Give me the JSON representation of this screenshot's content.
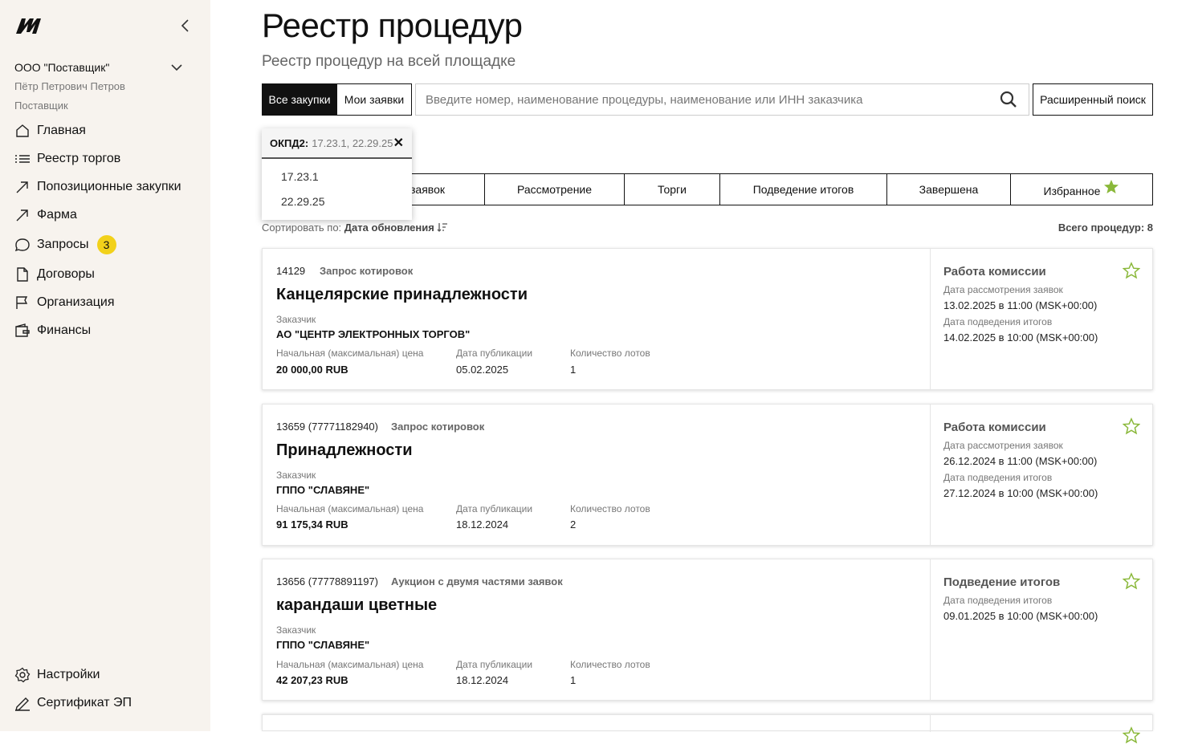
{
  "sidebar": {
    "org": "ООО \"Поставщик\"",
    "user_name": "Пётр Петрович Петров",
    "user_role": "Поставщик",
    "nav": [
      {
        "label": "Главная",
        "icon": "home-icon"
      },
      {
        "label": "Реестр торгов",
        "icon": "list-icon"
      },
      {
        "label": "Попозиционные закупки",
        "icon": "arrow-up-right-icon"
      },
      {
        "label": "Фарма",
        "icon": "arrow-up-right-icon"
      },
      {
        "label": "Запросы",
        "icon": "chat-icon",
        "badge": "3"
      },
      {
        "label": "Договоры",
        "icon": "document-icon"
      },
      {
        "label": "Организация",
        "icon": "flag-icon"
      },
      {
        "label": "Финансы",
        "icon": "wallet-icon"
      }
    ],
    "bottom": [
      {
        "label": "Настройки",
        "icon": "gear-icon"
      },
      {
        "label": "Сертификат ЭП",
        "icon": "signature-icon"
      }
    ]
  },
  "header": {
    "title": "Реестр процедур",
    "subtitle": "Реестр процедур на всей площадке"
  },
  "toolbar": {
    "all_label": "Все закупки",
    "mine_label": "Мои заявки",
    "search_placeholder": "Введите номер, наименование процедуры, наименование или ИНН заказчика",
    "advanced_label": "Расширенный поиск"
  },
  "filter": {
    "name": "ОКПД2:",
    "values": "17.23.1, 22.29.25",
    "options": [
      "17.23.1",
      "22.29.25"
    ]
  },
  "tabs": [
    "Подача заявок",
    "Рассмотрение",
    "Торги",
    "Подведение итогов",
    "Завершена",
    "Избранное"
  ],
  "tab_visible_first": "заявок",
  "sort": {
    "label": "Сортировать по:",
    "value": "Дата обновления"
  },
  "total": "Всего процедур: 8",
  "labels": {
    "customer": "Заказчик",
    "price": "Начальная (максимальная) цена",
    "pub_date": "Дата публикации",
    "lots": "Количество лотов"
  },
  "cards": [
    {
      "number": "14129",
      "type": "Запрос котировок",
      "name": "Канцелярские принадлежности",
      "customer": "АО \"ЦЕНТР ЭЛЕКТРОННЫХ ТОРГОВ\"",
      "price": "20 000,00 RUB",
      "pub_date": "05.02.2025",
      "lots": "1",
      "status": "Работа комиссии",
      "dates": [
        {
          "label": "Дата рассмотрения заявок",
          "value": "13.02.2025 в 11:00 (MSK+00:00)"
        },
        {
          "label": "Дата подведения итогов",
          "value": "14.02.2025 в 10:00 (MSK+00:00)"
        }
      ]
    },
    {
      "number": "13659 (77771182940)",
      "type": "Запрос котировок",
      "name": "Принадлежности",
      "customer": "ГППО \"СЛАВЯНЕ\"",
      "price": "91 175,34 RUB",
      "pub_date": "18.12.2024",
      "lots": "2",
      "status": "Работа комиссии",
      "dates": [
        {
          "label": "Дата рассмотрения заявок",
          "value": "26.12.2024 в 11:00 (MSK+00:00)"
        },
        {
          "label": "Дата подведения итогов",
          "value": "27.12.2024 в 10:00 (MSK+00:00)"
        }
      ]
    },
    {
      "number": "13656 (77778891197)",
      "type": "Аукцион с двумя частями заявок",
      "name": "карандаши цветные",
      "customer": "ГППО \"СЛАВЯНЕ\"",
      "price": "42 207,23 RUB",
      "pub_date": "18.12.2024",
      "lots": "1",
      "status": "Подведение итогов",
      "dates": [
        {
          "label": "Дата подведения итогов",
          "value": "09.01.2025 в 10:00 (MSK+00:00)"
        }
      ]
    }
  ],
  "colors": {
    "accent_star": "#8ab83a",
    "badge": "#f2d11a",
    "sidebar_bg": "#f7f3ee"
  }
}
